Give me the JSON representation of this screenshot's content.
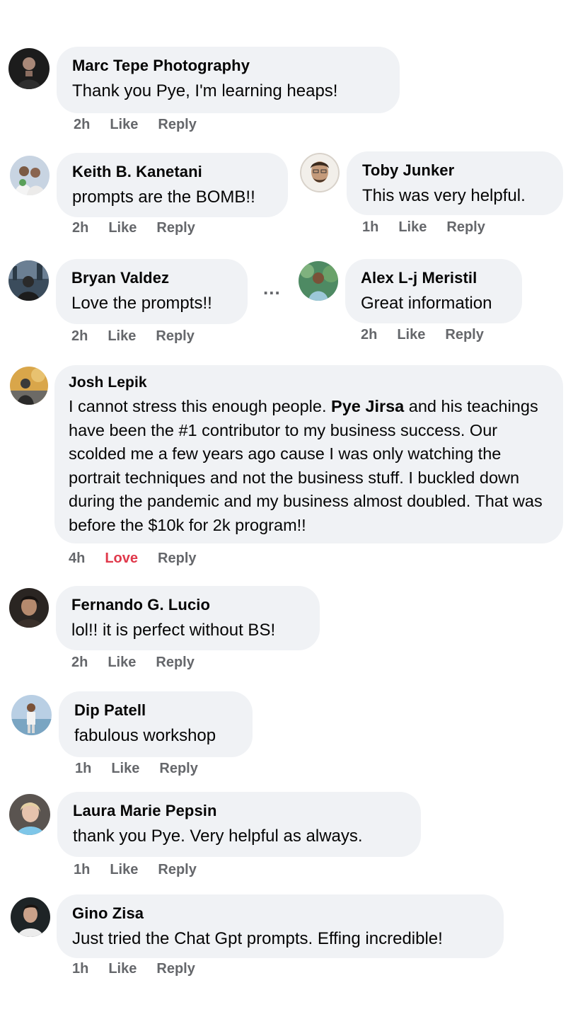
{
  "comments": [
    {
      "name": "Marc Tepe Photography",
      "text": "Thank you Pye, I'm learning heaps!",
      "time": "2h",
      "like": "Like",
      "reply": "Reply"
    },
    {
      "name": "Keith B. Kanetani",
      "text": "prompts are the BOMB!!",
      "time": "2h",
      "like": "Like",
      "reply": "Reply"
    },
    {
      "name": "Toby Junker",
      "text": "This was very helpful.",
      "time": "1h",
      "like": "Like",
      "reply": "Reply"
    },
    {
      "name": "Bryan Valdez",
      "text": "Love the prompts!!",
      "time": "2h",
      "like": "Like",
      "reply": "Reply"
    },
    {
      "name": "Alex L-j Meristil",
      "text": "Great information",
      "time": "2h",
      "like": "Like",
      "reply": "Reply"
    },
    {
      "name": "Josh Lepik",
      "text_before": "I cannot stress this enough people. ",
      "mention": "Pye Jirsa",
      "text_after": " and his teachings have been the #1 contributor to my business success. Our scolded me a few years ago cause I was only watching the portrait techniques and not the business stuff. I buckled down during the pandemic and my business almost doubled. That was before the $10k for 2k program!!",
      "time": "4h",
      "like": "Love",
      "reply": "Reply"
    },
    {
      "name": "Fernando G. Lucio",
      "text": "lol!! it is perfect without BS!",
      "time": "2h",
      "like": "Like",
      "reply": "Reply"
    },
    {
      "name": "Dip Patell",
      "text": "fabulous workshop",
      "time": "1h",
      "like": "Like",
      "reply": "Reply"
    },
    {
      "name": "Laura Marie Pepsin",
      "text": "thank you Pye. Very helpful as always.",
      "time": "1h",
      "like": "Like",
      "reply": "Reply"
    },
    {
      "name": "Gino Zisa",
      "text": "Just tried the Chat Gpt prompts. Effing incredible!",
      "time": "1h",
      "like": "Like",
      "reply": "Reply"
    }
  ],
  "more_icon": "ellipsis-icon",
  "more_label": "...",
  "colors": {
    "bubble": "#f0f2f5",
    "meta": "#65676b",
    "love": "#e0394b"
  }
}
